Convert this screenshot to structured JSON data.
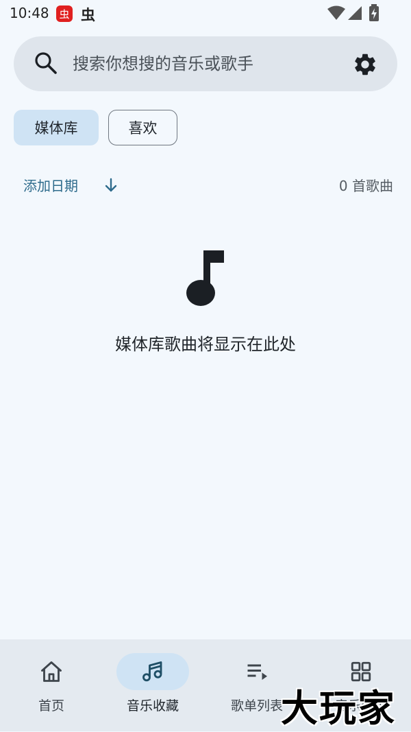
{
  "status_bar": {
    "time": "10:48",
    "app_badge_1": "虫",
    "app_badge_2": "虫"
  },
  "search": {
    "placeholder": "搜索你想搜的音乐或歌手"
  },
  "chips": {
    "library": "媒体库",
    "favorites": "喜欢"
  },
  "sort": {
    "label": "添加日期",
    "count": "0 首歌曲"
  },
  "empty_state": {
    "message": "媒体库歌曲将显示在此处"
  },
  "nav": {
    "items": [
      {
        "label": "首页",
        "icon": "home-icon"
      },
      {
        "label": "音乐收藏",
        "icon": "music-note-icon"
      },
      {
        "label": "歌单列表",
        "icon": "playlist-icon"
      },
      {
        "label": "音乐分类",
        "icon": "grid-icon"
      }
    ],
    "active_index": 1
  },
  "watermark": "大玩家",
  "colors": {
    "background": "#f3f8fd",
    "accent": "#2e6b8c",
    "chip_selected": "#cfe3f4",
    "search_bg": "#dfe5ec",
    "nav_bg": "#e4eaf0"
  }
}
